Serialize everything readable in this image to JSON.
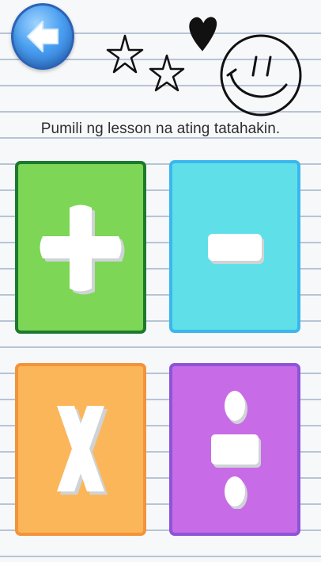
{
  "instruction": "Pumili ng lesson na ating tatahakin.",
  "icons": {
    "back": "arrow-left-icon",
    "doodles": [
      "star-icon",
      "star-icon",
      "heart-icon",
      "smiley-face-icon"
    ]
  },
  "lessons": [
    {
      "name": "addition",
      "symbol": "plus-icon",
      "color": "#7dd655",
      "border": "#1c7a2f"
    },
    {
      "name": "subtraction",
      "symbol": "minus-icon",
      "color": "#5fe0e8",
      "border": "#3ab7ee"
    },
    {
      "name": "multiplication",
      "symbol": "multiply-icon",
      "color": "#fbb65a",
      "border": "#f3933a"
    },
    {
      "name": "division",
      "symbol": "divide-icon",
      "color": "#c86be6",
      "border": "#8c55d8"
    }
  ]
}
